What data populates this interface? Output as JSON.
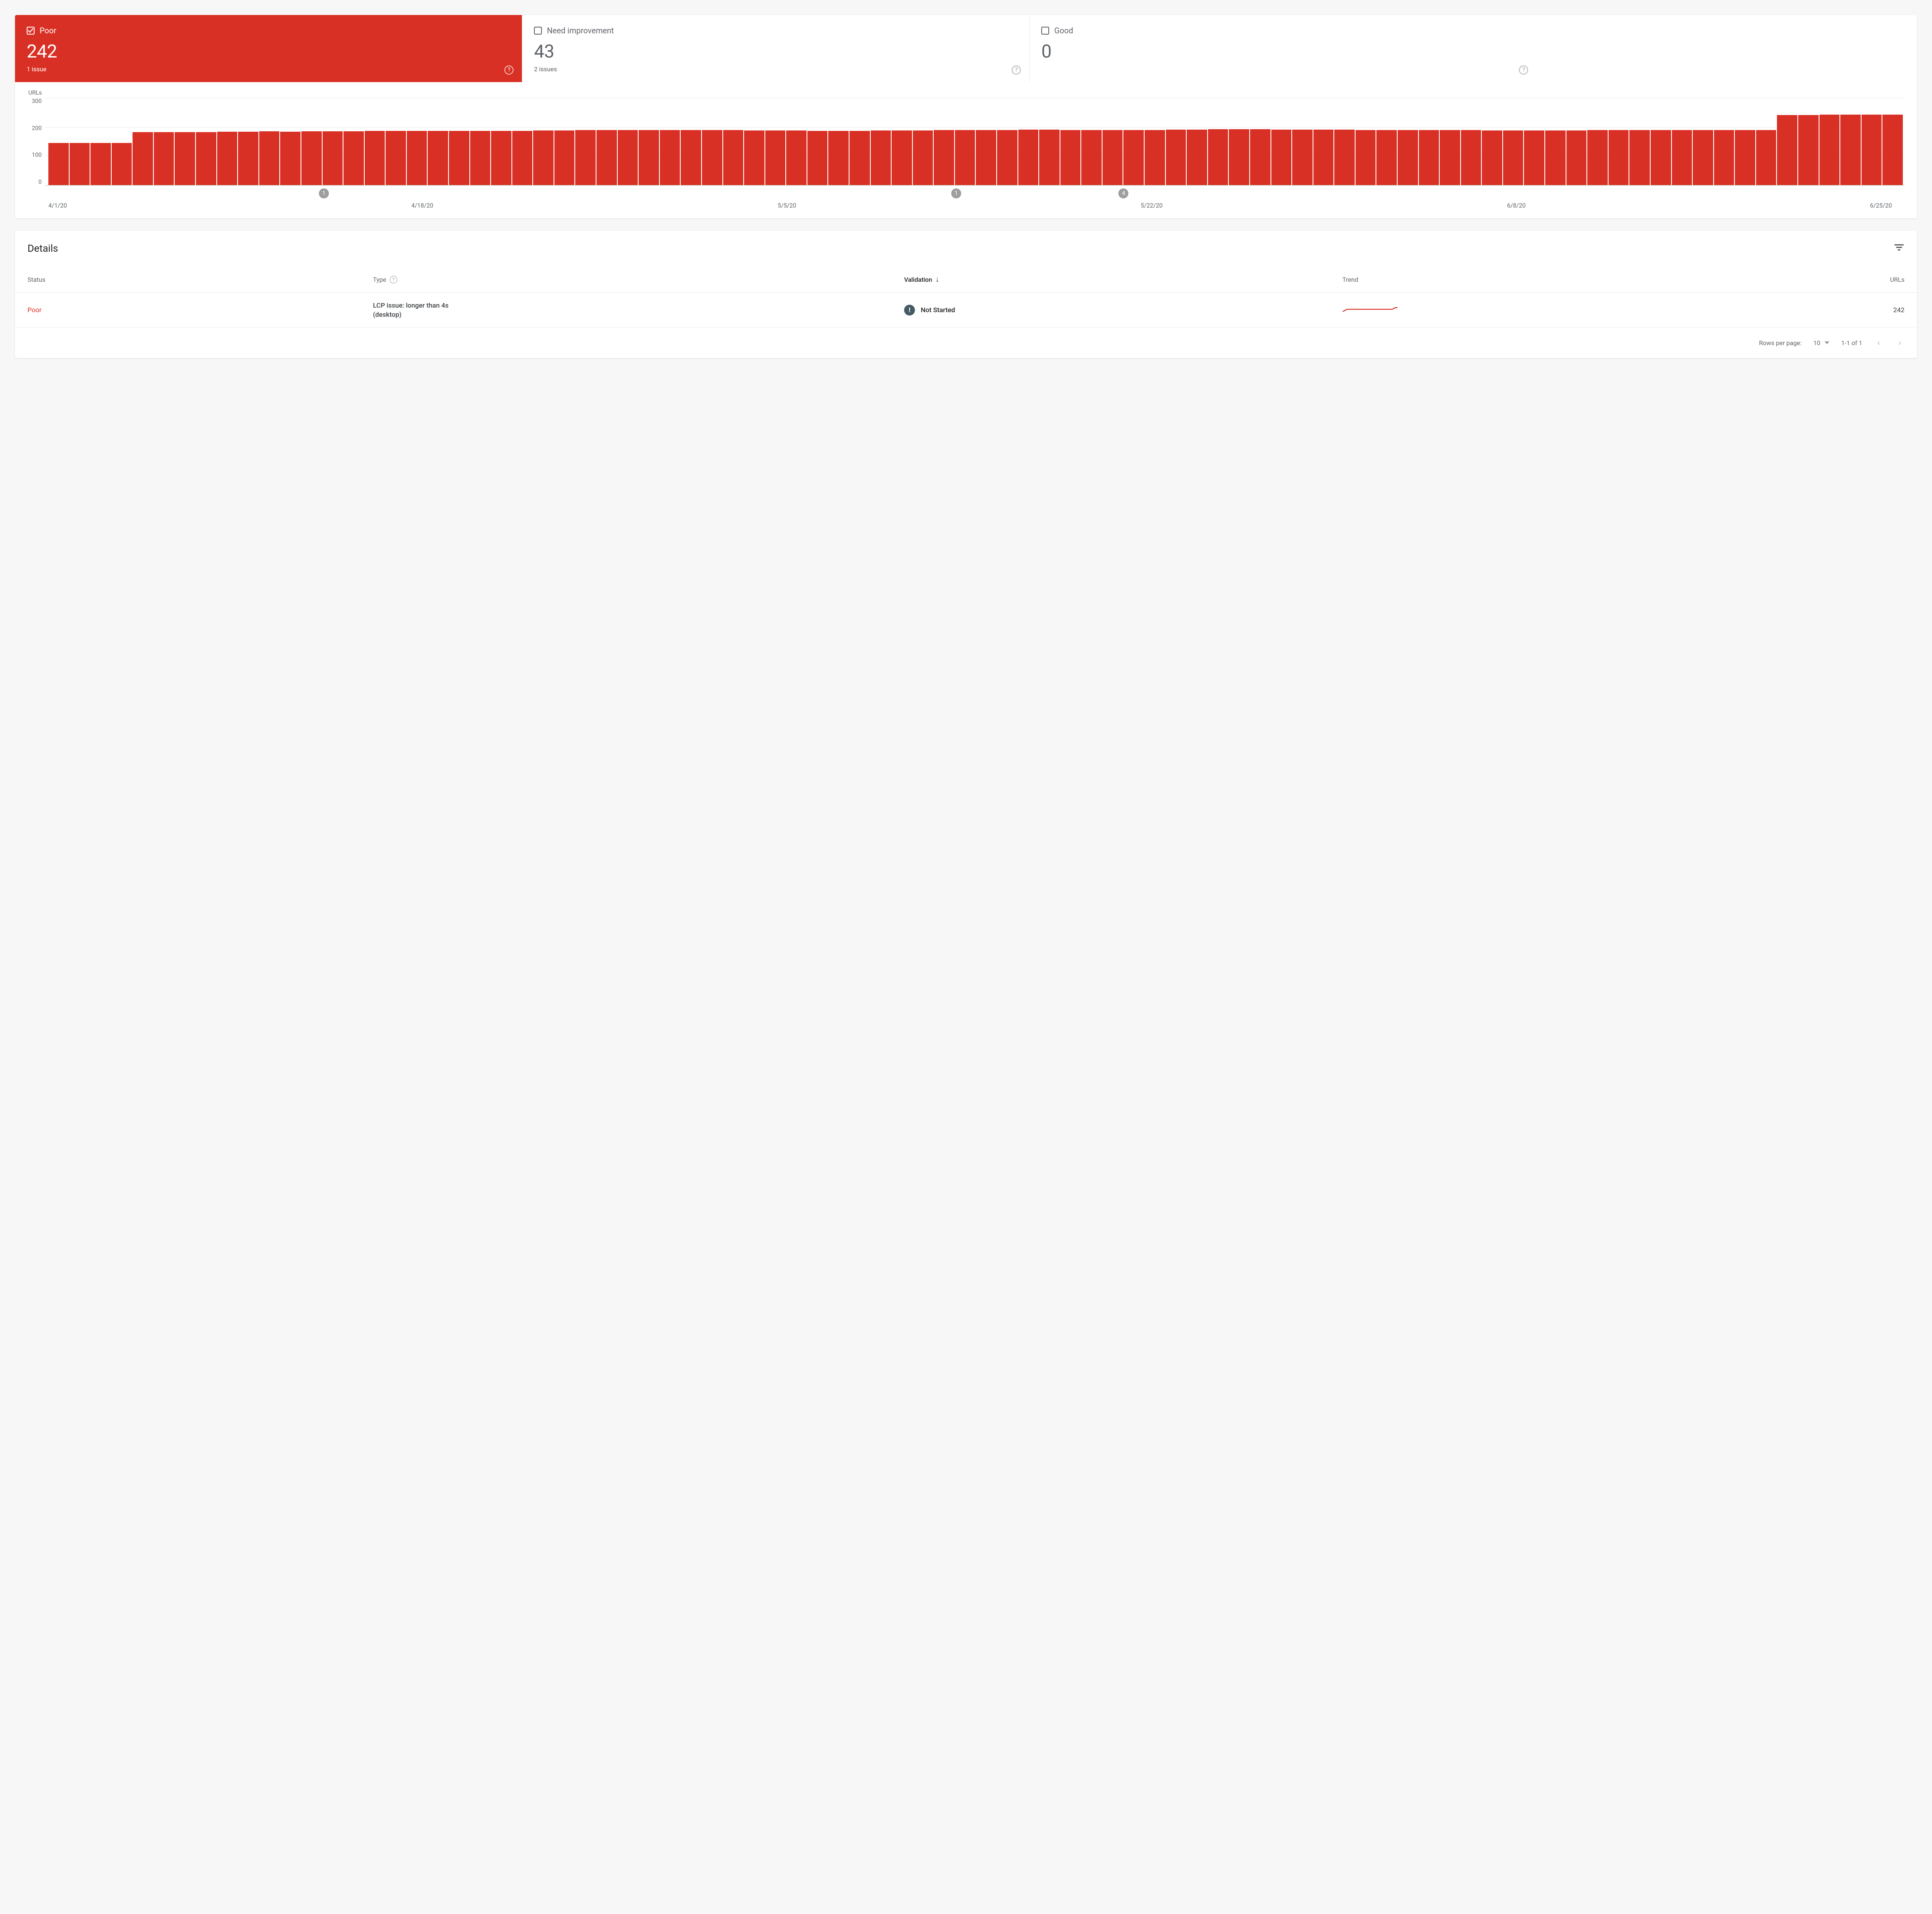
{
  "tiles": [
    {
      "label": "Poor",
      "value": "242",
      "sub": "1 issue",
      "selected": true
    },
    {
      "label": "Need improvement",
      "value": "43",
      "sub": "2 issues",
      "selected": false
    },
    {
      "label": "Good",
      "value": "0",
      "sub": "",
      "selected": false
    }
  ],
  "chart_data": {
    "type": "bar",
    "ylabel": "URLs",
    "ylim": [
      0,
      300
    ],
    "yticks": [
      0,
      100,
      200,
      300
    ],
    "xticks": [
      "4/1/20",
      "4/18/20",
      "5/5/20",
      "5/22/20",
      "6/8/20",
      "6/25/20"
    ],
    "values": [
      145,
      145,
      145,
      145,
      182,
      182,
      183,
      183,
      184,
      184,
      185,
      184,
      185,
      185,
      185,
      186,
      186,
      187,
      187,
      186,
      186,
      187,
      187,
      188,
      188,
      189,
      189,
      189,
      190,
      190,
      189,
      189,
      189,
      188,
      188,
      188,
      187,
      187,
      187,
      188,
      188,
      188,
      189,
      190,
      190,
      190,
      191,
      191,
      190,
      190,
      189,
      189,
      190,
      191,
      191,
      192,
      192,
      192,
      191,
      191,
      191,
      191,
      190,
      190,
      190,
      190,
      190,
      189,
      188,
      188,
      188,
      188,
      188,
      189,
      189,
      189,
      190,
      190,
      190,
      190,
      190,
      190,
      241,
      241,
      242,
      242,
      242,
      242
    ],
    "markers": [
      {
        "label": "1",
        "pos_pct": 15
      },
      {
        "label": "1",
        "pos_pct": 49
      },
      {
        "label": "4",
        "pos_pct": 58
      }
    ]
  },
  "details": {
    "title": "Details",
    "columns": {
      "status": "Status",
      "type": "Type",
      "validation": "Validation",
      "trend": "Trend",
      "urls": "URLs"
    },
    "rows": [
      {
        "status": "Poor",
        "type": "LCP issue: longer than 4s (desktop)",
        "validation": "Not Started",
        "urls": "242"
      }
    ],
    "pager": {
      "rows_label": "Rows per page:",
      "rows_value": "10",
      "range": "1-1 of 1"
    }
  }
}
